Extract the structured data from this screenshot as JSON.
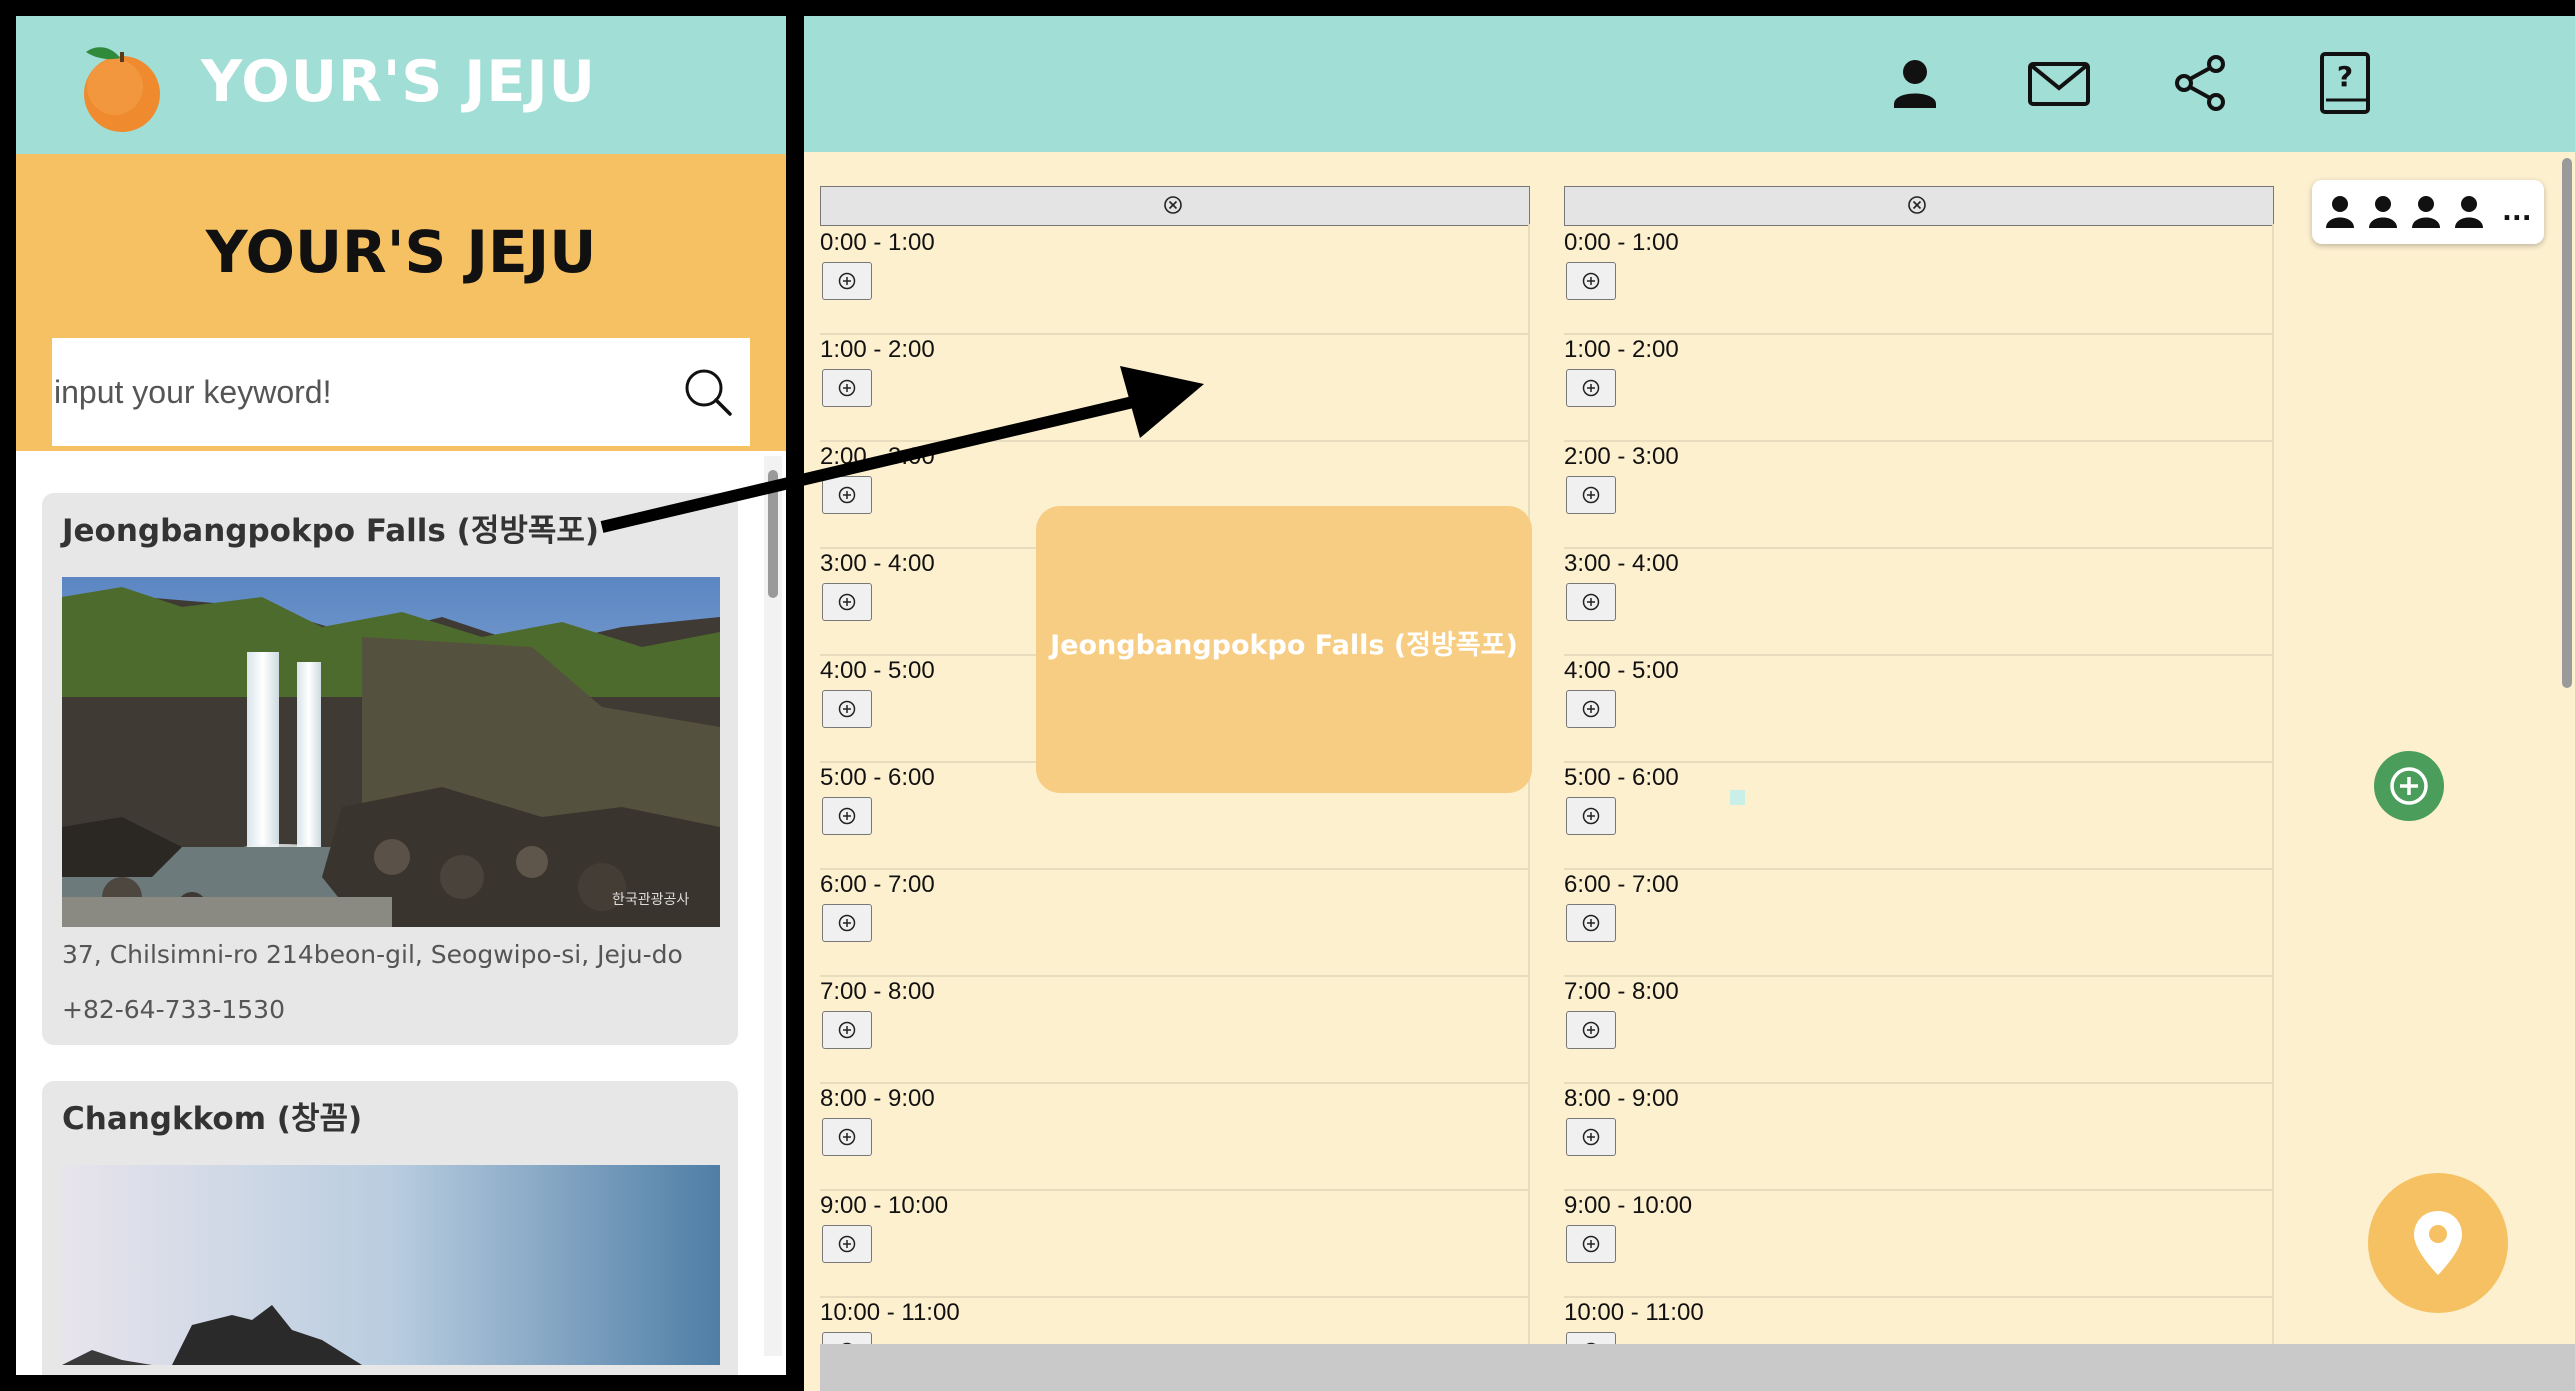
{
  "app": {
    "brand": "YOUR'S JEJU",
    "hero_title": "YOUR'S JEJU"
  },
  "search": {
    "placeholder": "input your keyword!",
    "value": ""
  },
  "places": [
    {
      "name": "Jeongbangpokpo Falls (정방폭포)",
      "address": "37, Chilsimni-ro 214beon-gil, Seogwipo-si, Jeju-do",
      "phone": "+82-64-733-1530",
      "image_watermark": "한국관광공사"
    },
    {
      "name": "Changkkom (창꼼)"
    }
  ],
  "toolbar": {
    "icons": [
      "user-icon",
      "mail-icon",
      "share-icon",
      "help-book-icon"
    ]
  },
  "schedule": {
    "columns": [
      {
        "slots": [
          "0:00 - 1:00",
          "1:00 - 2:00",
          "2:00 - 3:00",
          "3:00 - 4:00",
          "4:00 - 5:00",
          "5:00 - 6:00",
          "6:00 - 7:00",
          "7:00 - 8:00",
          "8:00 - 9:00",
          "9:00 - 10:00",
          "10:00 - 11:00"
        ]
      },
      {
        "slots": [
          "0:00 - 1:00",
          "1:00 - 2:00",
          "2:00 - 3:00",
          "3:00 - 4:00",
          "4:00 - 5:00",
          "5:00 - 6:00",
          "6:00 - 7:00",
          "7:00 - 8:00",
          "8:00 - 9:00",
          "9:00 - 10:00",
          "10:00 - 11:00"
        ]
      }
    ],
    "dragged_event": {
      "title": "Jeongbangpokpo Falls (정방폭포)"
    }
  },
  "members": {
    "more": "..."
  },
  "colors": {
    "mint": "#a1ded6",
    "yellow": "#f5c162",
    "cream": "#fdf0cf",
    "event": "#f7cd83",
    "green": "#4a9d5a"
  }
}
